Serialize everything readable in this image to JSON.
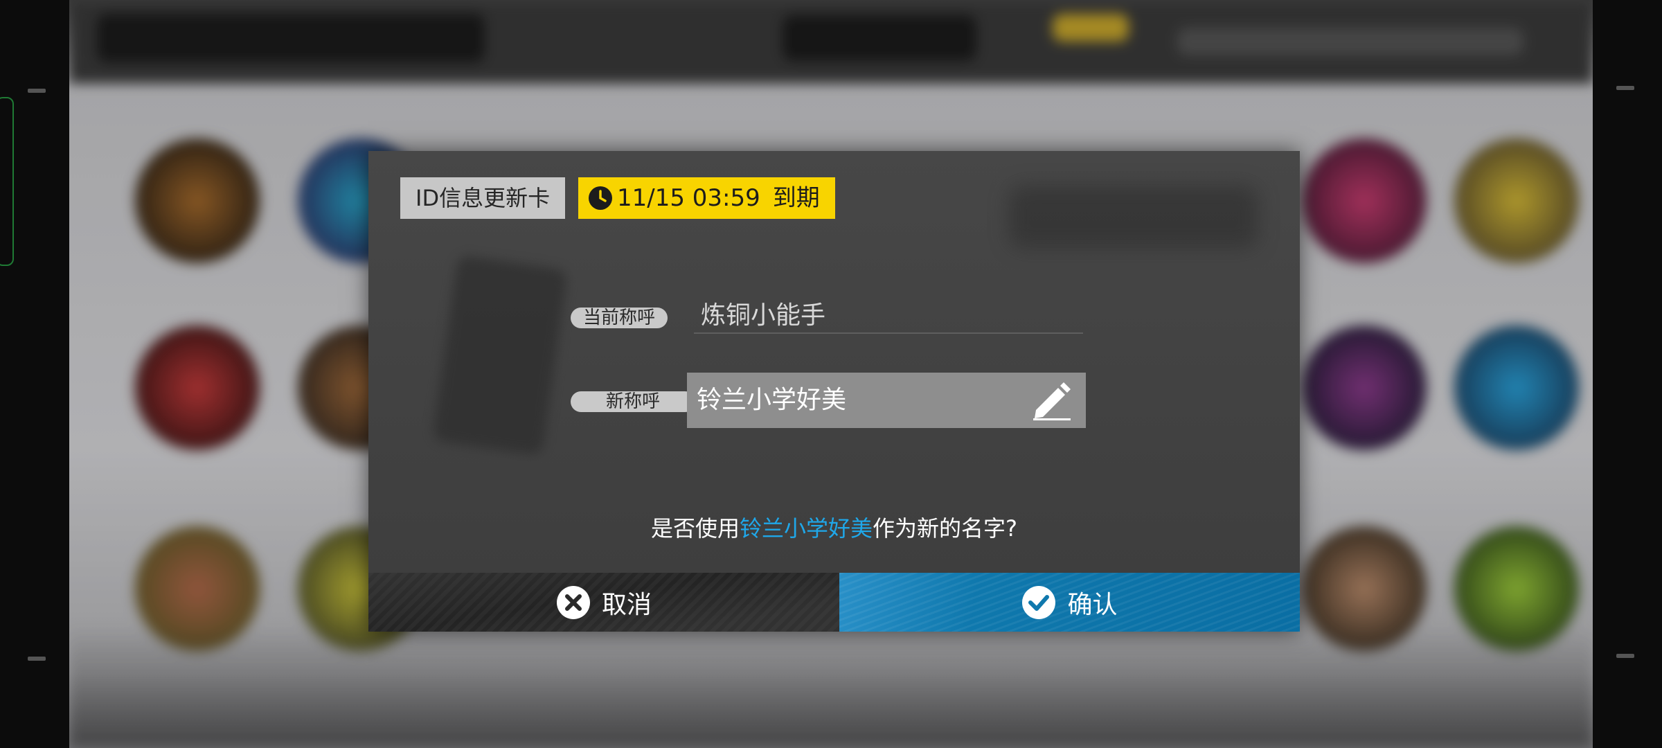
{
  "dialog": {
    "item_tag": "ID信息更新卡",
    "expiry": {
      "icon": "clock-icon",
      "time": "11/15 03:59",
      "label": "到期"
    },
    "current_name": {
      "label": "当前称呼",
      "value": "炼铜小能手"
    },
    "new_name": {
      "label": "新称呼",
      "value": "铃兰小学好美",
      "icon": "pencil-icon"
    },
    "question": {
      "prefix": "是否使用",
      "highlight": "铃兰小学好美",
      "suffix": "作为新的名字?"
    },
    "buttons": {
      "cancel": {
        "label": "取消",
        "icon": "close-circle-icon"
      },
      "confirm": {
        "label": "确认",
        "icon": "check-circle-icon"
      }
    }
  },
  "colors": {
    "expiry_tag": "#f8d400",
    "highlight_text": "#1fa8ea",
    "confirm_button": "#0f78ad",
    "tag_background": "#c7c7c7"
  }
}
